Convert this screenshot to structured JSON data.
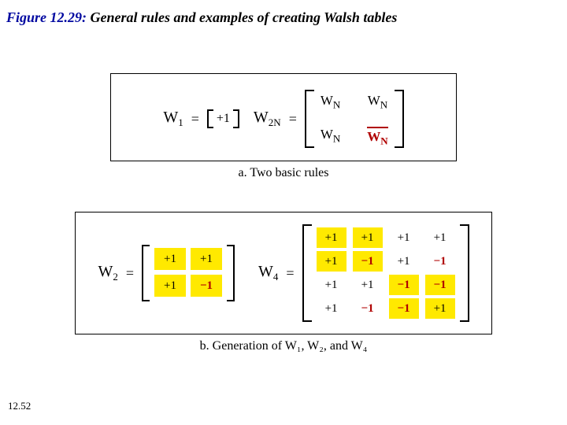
{
  "title": {
    "fig": "Figure 12.29: ",
    "rest": "General rules and examples of creating Walsh tables"
  },
  "footer": "12.52",
  "panel_a": {
    "w1_lhs_var": "W",
    "w1_lhs_sub": "1",
    "eq": "=",
    "w1_cell": "+1",
    "w2n_lhs_var": "W",
    "w2n_lhs_sub": "2N",
    "block": {
      "r0c0_var": "W",
      "r0c0_sub": "N",
      "r0c1_var": "W",
      "r0c1_sub": "N",
      "r1c0_var": "W",
      "r1c0_sub": "N",
      "r1c1_var": "W",
      "r1c1_sub": "N"
    },
    "caption": "a. Two basic rules"
  },
  "panel_b": {
    "w2_lhs_var": "W",
    "w2_lhs_sub": "2",
    "eq": "=",
    "w4_lhs_var": "W",
    "w4_lhs_sub": "4",
    "caption": "b. Generation of W₁, W₂, and W₄"
  },
  "chart_data": [
    {
      "type": "table",
      "title": "W2",
      "values": [
        [
          1,
          1
        ],
        [
          1,
          -1
        ]
      ]
    },
    {
      "type": "table",
      "title": "W4",
      "values": [
        [
          1,
          1,
          1,
          1
        ],
        [
          1,
          -1,
          1,
          -1
        ],
        [
          1,
          1,
          -1,
          -1
        ],
        [
          1,
          -1,
          -1,
          1
        ]
      ]
    }
  ],
  "cells": {
    "p1": "+1",
    "m1": "−1"
  }
}
